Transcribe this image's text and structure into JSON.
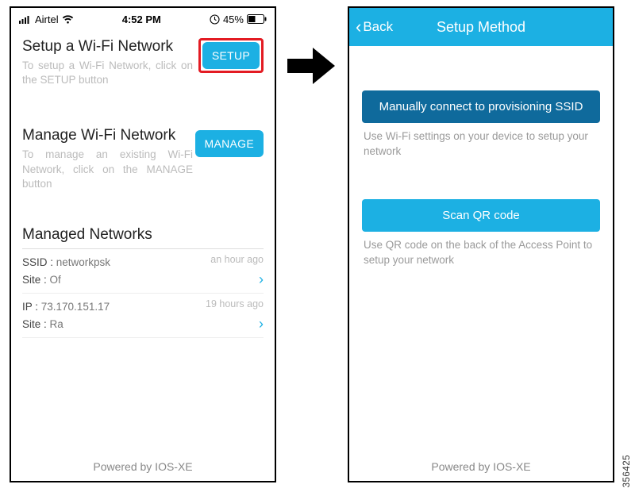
{
  "statusbar": {
    "carrier": "Airtel",
    "time": "4:52 PM",
    "battery_pct": "45%"
  },
  "screenA": {
    "setup": {
      "title": "Setup a Wi-Fi Network",
      "subtitle": "To setup a Wi-Fi Network, click on the SETUP button",
      "button": "SETUP"
    },
    "manage": {
      "title": "Manage Wi-Fi Network",
      "subtitle": "To manage an existing Wi-Fi Network, click on the MANAGE button",
      "button": "MANAGE"
    },
    "networks": {
      "header": "Managed Networks",
      "items": [
        {
          "l1_label": "SSID : ",
          "l1_value": "networkpsk",
          "l2_label": "Site : ",
          "l2_value": "Of",
          "time": "an hour ago"
        },
        {
          "l1_label": "IP : ",
          "l1_value": "73.170.151.17",
          "l2_label": "Site : ",
          "l2_value": "Ra",
          "time": "19 hours ago"
        }
      ]
    },
    "footer": "Powered by IOS-XE"
  },
  "screenB": {
    "back": "Back",
    "title": "Setup Method",
    "opt1": {
      "button": "Manually connect to provisioning SSID",
      "desc": "Use Wi-Fi settings on your device to setup your network"
    },
    "opt2": {
      "button": "Scan QR code",
      "desc": "Use QR code on the back of the Access Point to setup your network"
    },
    "footer": "Powered by IOS-XE"
  },
  "figure_id": "356425"
}
